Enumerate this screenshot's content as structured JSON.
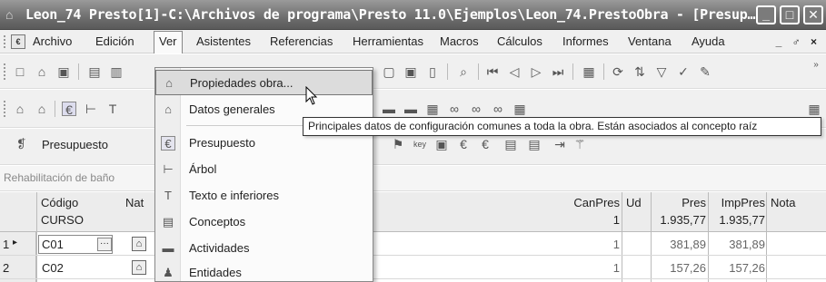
{
  "window": {
    "title": "Leon_74 Presto[1]-C:\\Archivos de programa\\Presto 11.0\\Ejemplos\\Leon_74.PrestoObra - [Presup…",
    "controls": {
      "minimize": "_",
      "restore": "□",
      "close": "✕"
    }
  },
  "menubar": {
    "items": [
      "Archivo",
      "Edición",
      "Ver",
      "Asistentes",
      "Referencias",
      "Herramientas",
      "Macros",
      "Cálculos",
      "Informes",
      "Ventana",
      "Ayuda"
    ],
    "open_item": "Ver",
    "mdi_controls": "_ ♂ ×"
  },
  "combo": {
    "label": "Presupuesto"
  },
  "breadcrumb": "Rehabilitación de baño",
  "grid": {
    "headers": {
      "codigo": "Código",
      "curso": "CURSO",
      "nat": "Nat",
      "canpres": "CanPres",
      "canpres_val": "1",
      "ud": "Ud",
      "pres": "Pres",
      "pres_val": "1.935,77",
      "imppres": "ImpPres",
      "imppres_val": "1.935,77",
      "nota": "Nota"
    },
    "rows": [
      {
        "num": "1",
        "marker": "▸",
        "code": "C01",
        "canpres": "1",
        "pres": "381,89",
        "imppres": "381,89"
      },
      {
        "num": "2",
        "marker": "",
        "code": "C02",
        "canpres": "1",
        "pres": "157,26",
        "imppres": "157,26"
      }
    ]
  },
  "dropdown": {
    "items": [
      {
        "label": "Propiedades obra...",
        "icon": "house-icon",
        "highlighted": true
      },
      {
        "label": "Datos generales",
        "icon": "data-icon"
      },
      {
        "label": "Presupuesto",
        "icon": "euro-icon"
      },
      {
        "label": "Árbol",
        "icon": "tree-icon"
      },
      {
        "label": "Texto e inferiores",
        "icon": "text-icon"
      },
      {
        "label": "Conceptos",
        "icon": "concepts-icon"
      },
      {
        "label": "Actividades",
        "icon": "activities-icon"
      },
      {
        "label": "Entidades",
        "icon": "entities-icon"
      }
    ]
  },
  "tooltip": "Principales datos de configuración comunes a toda la obra. Están asociados al concepto raíz",
  "colors": {
    "titlebar": "#6e6e6e",
    "menu_highlight": "#dcdcdc",
    "grid_header": "#ececec"
  }
}
